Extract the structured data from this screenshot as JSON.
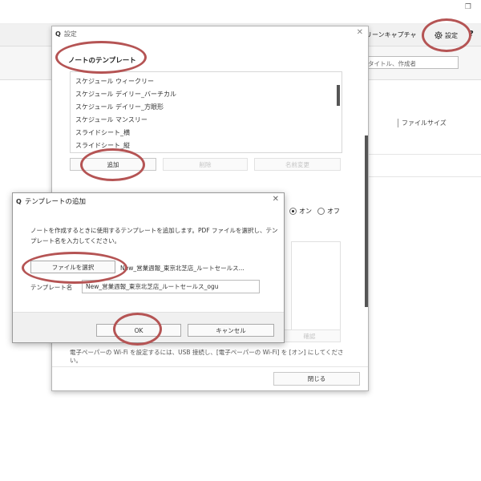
{
  "app": {
    "maximize_glyph": "❐",
    "screen_capture_label": "リーンキャプチャ",
    "settings_label": "設定",
    "help_label": "?",
    "search_placeholder": "タイトル、作成者",
    "column_file_size": "ファイルサイズ"
  },
  "settings_dialog": {
    "title": "設定",
    "close_glyph": "✕",
    "section_heading": "ノートのテンプレート",
    "templates": [
      "スケジュール ウィークリー",
      "スケジュール デイリー_バーチカル",
      "スケジュール デイリー_方眼形",
      "スケジュール マンスリー",
      "スライドシート_横",
      "スライドシート_縦"
    ],
    "add_button": "追加",
    "delete_button": "削除",
    "rename_button": "名前変更",
    "wifi_on_label": "オン",
    "wifi_off_label": "オフ",
    "hidden_button_label": "確認",
    "wifi_note": "電子ペーパーの Wi-Fi を設定するには、USB 接続し、[電子ペーパーの Wi-Fi] を [オン] にしてください。",
    "close_button": "閉じる"
  },
  "add_dialog": {
    "title": "テンプレートの追加",
    "close_glyph": "✕",
    "description": "ノートを作成するときに使用するテンプレートを追加します。PDF ファイルを選択し、テンプレート名を入力してください。",
    "select_file_button": "ファイルを選択",
    "file_name": "New_営業週報_東京北芝店_ルートセールス...",
    "template_name_label": "テンプレート名",
    "template_name_value": "New_営業週報_東京北芝店_ルートセールス_ogu",
    "ok_button": "OK",
    "cancel_button": "キャンセル"
  },
  "colors": {
    "annotation": "#b55454",
    "dialog_border": "#b5b5b5",
    "footer_bg": "#f0f0f0"
  }
}
